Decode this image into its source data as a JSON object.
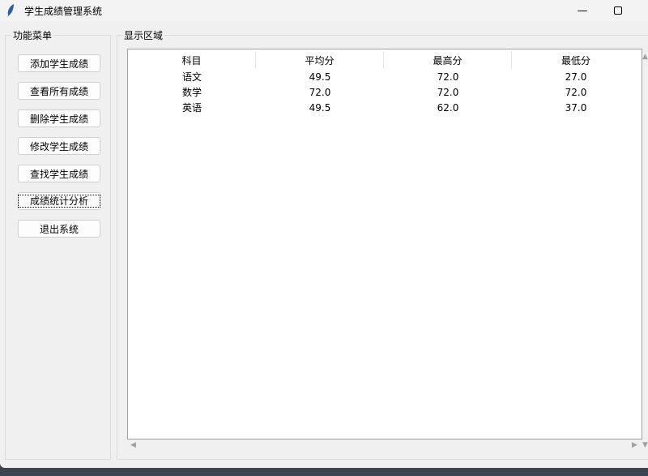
{
  "window": {
    "title": "学生成绩管理系统",
    "minimize": "—",
    "maximize": "☐"
  },
  "menu": {
    "label": "功能菜单",
    "buttons": [
      "添加学生成绩",
      "查看所有成绩",
      "删除学生成绩",
      "修改学生成绩",
      "查找学生成绩",
      "成绩统计分析",
      "退出系统"
    ]
  },
  "display": {
    "label": "显示区域",
    "columns": [
      "科目",
      "平均分",
      "最高分",
      "最低分"
    ],
    "rows": [
      [
        "语文",
        "49.5",
        "72.0",
        "27.0"
      ],
      [
        "数学",
        "72.0",
        "72.0",
        "72.0"
      ],
      [
        "英语",
        "49.5",
        "62.0",
        "37.0"
      ]
    ]
  }
}
